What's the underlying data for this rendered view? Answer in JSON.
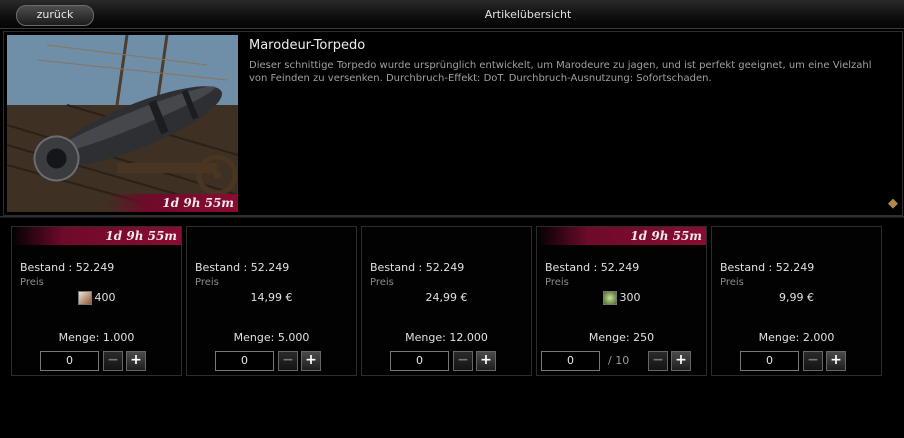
{
  "header": {
    "back_label": "zurück",
    "title": "Artikelübersicht"
  },
  "item": {
    "name": "Marodeur-Torpedo",
    "description": "Dieser schnittige Torpedo wurde ursprünglich entwickelt, um Marodeure zu jagen, und ist perfekt geeignet, um eine Vielzahl von Feinden zu versenken. Durchbruch-Effekt: DoT. Durchbruch-Ausnutzung: Sofortschaden.",
    "timer": "1d 9h 55m",
    "side_handle_icon": "resize-handle-icon"
  },
  "colors": {
    "timer_bg": "#8a0c33",
    "background": "#000000"
  },
  "offers": [
    {
      "timer": "1d 9h 55m",
      "stock": "Bestand  : 52.249",
      "price_label": "Preis",
      "price": "400",
      "price_icon": "premium-currency-icon",
      "amount": "Menge: 1.000",
      "quantity": "0",
      "minus": "−",
      "plus": "+"
    },
    {
      "timer": "",
      "stock": "Bestand  : 52.249",
      "price_label": "Preis",
      "price": "14,99 €",
      "price_icon": "",
      "amount": "Menge: 5.000",
      "quantity": "0",
      "minus": "−",
      "plus": "+"
    },
    {
      "timer": "",
      "stock": "Bestand  : 52.249",
      "price_label": "Preis",
      "price": "24,99 €",
      "price_icon": "",
      "amount": "Menge: 12.000",
      "quantity": "0",
      "minus": "−",
      "plus": "+"
    },
    {
      "timer": "1d 9h 55m",
      "stock": "Bestand  : 52.249",
      "price_label": "Preis",
      "price": "300",
      "price_icon": "event-currency-icon",
      "amount": "Menge: 250",
      "quantity": "0",
      "max": "/ 10",
      "minus": "−",
      "plus": "+"
    },
    {
      "timer": "",
      "stock": "Bestand  : 52.249",
      "price_label": "Preis",
      "price": "9,99 €",
      "price_icon": "",
      "amount": "Menge: 2.000",
      "quantity": "0",
      "minus": "−",
      "plus": "+"
    }
  ]
}
